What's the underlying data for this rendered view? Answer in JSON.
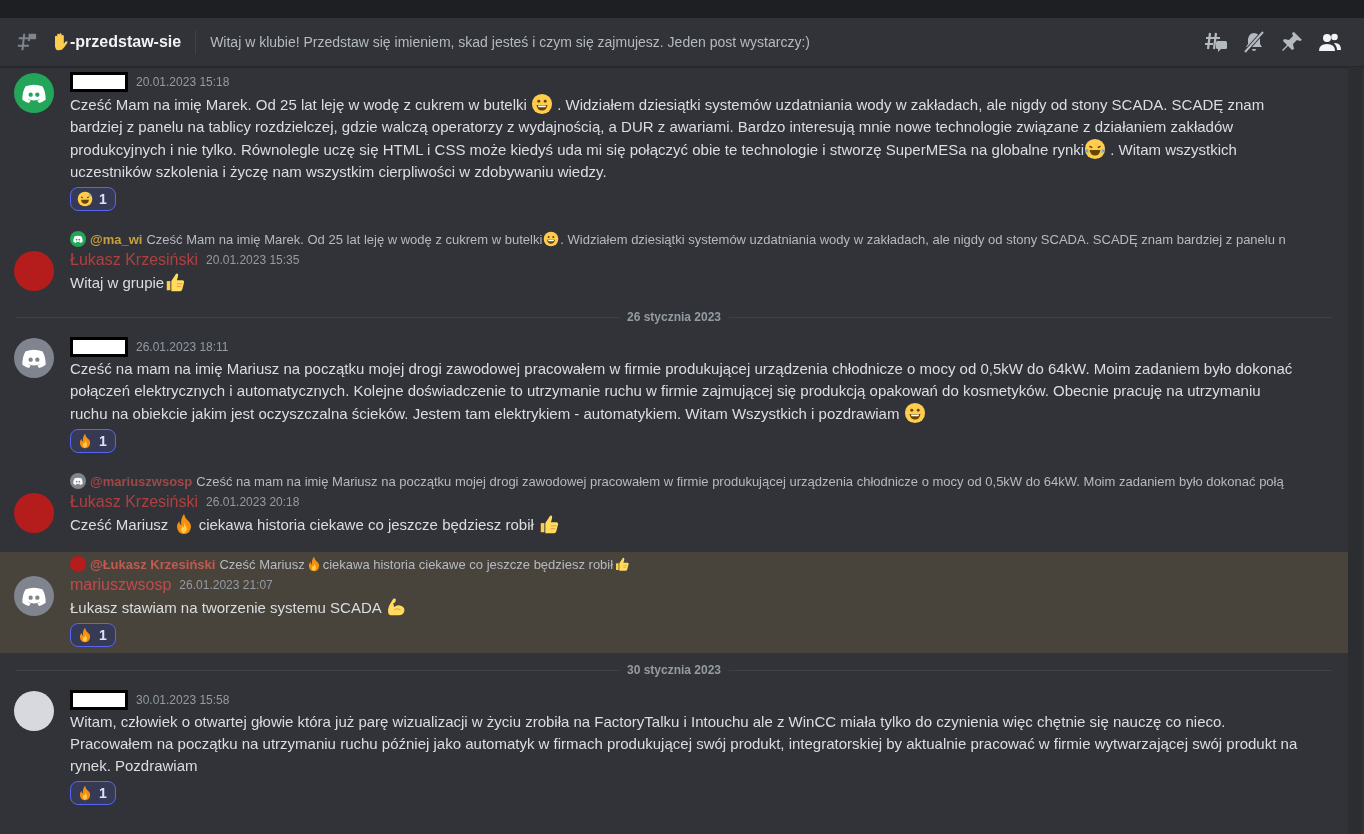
{
  "header": {
    "channel": "-przedstaw-sie",
    "topic": "Witaj w klubie! Przedstaw się imieniem, skad jesteś i czym się zajmujesz. Jeden post wystarczy:)"
  },
  "feed": [
    {
      "kind": "message",
      "avatar": {
        "kind": "logo",
        "color": "#23a55a"
      },
      "time": "20.01.2023 15:18",
      "highlighted": false,
      "content": [
        "Cześć Mam na imię Marek. Od 25 lat leję w wodę z cukrem w butelki ",
        {
          "kind": "grin"
        },
        " . Widziałem dziesiątki systemów uzdatniania wody w zakładach, ale nigdy od stony SCADA. SCADĘ znam bardziej z panelu na tablicy rozdzielczej, gdzie walczą operatorzy z wydajnością, a DUR z awariami. Bardzo interesują mnie nowe technologie związane z działaniem zakładów produkcyjnych i nie tylko.  Równolegle uczę się HTML i CSS może kiedyś uda mi się połączyć obie te technologie i stworzę SuperMESa na globalne rynki",
        {
          "kind": "joy"
        },
        " . Witam wszystkich uczestników szkolenia i życzę nam wszystkim cierpliwości w zdobywaniu wiedzy."
      ],
      "reactions": [
        {
          "kind": "sweat",
          "count": "1",
          "selected": true
        }
      ]
    },
    {
      "kind": "message",
      "avatar": {
        "kind": "photo",
        "color": "#b51c1c"
      },
      "author": {
        "name": "Łukasz Krzesiński",
        "color": "#b04040"
      },
      "time": "20.01.2023 15:35",
      "highlighted": false,
      "reply": {
        "avatar": {
          "kind": "logo",
          "color": "#23a55a"
        },
        "author": "@ma_wi",
        "color": "#c9a03a",
        "content": [
          "Cześć Mam na imię Marek. Od 25 lat leję w wodę z cukrem w butelki ",
          {
            "kind": "grin"
          },
          " . Widziałem dziesiątki systemów uzdatniania wody w zakładach, ale nigdy od stony SCADA. SCADĘ znam bardziej z panelu n"
        ]
      },
      "content": [
        "Witaj w grupie",
        {
          "kind": "thumbs"
        }
      ]
    },
    {
      "kind": "divider",
      "label": "26 stycznia 2023"
    },
    {
      "kind": "message",
      "avatar": {
        "kind": "logo",
        "color": "#80848e"
      },
      "time": "26.01.2023 18:11",
      "highlighted": false,
      "content": [
        "Cześć na mam na imię Mariusz na początku mojej drogi zawodowej pracowałem w firmie produkującej urządzenia chłodnicze o mocy od 0,5kW do 64kW. Moim zadaniem było dokonać połączeń elektrycznych i automatycznych. Kolejne doświadczenie to utrzymanie ruchu w firmie zajmującej się produkcją opakowań do kosmetyków. Obecnie pracuję na utrzymaniu ruchu na obiekcie jakim jest oczyszczalna ścieków. Jestem tam elektrykiem - automatykiem. Witam Wszystkich i pozdrawiam ",
        {
          "kind": "grin"
        }
      ],
      "reactions": [
        {
          "kind": "fire",
          "count": "1",
          "selected": true
        }
      ]
    },
    {
      "kind": "message",
      "avatar": {
        "kind": "photo",
        "color": "#b51c1c"
      },
      "author": {
        "name": "Łukasz Krzesiński",
        "color": "#b04040"
      },
      "time": "26.01.2023 20:18",
      "highlighted": false,
      "reply": {
        "avatar": {
          "kind": "logo",
          "color": "#80848e"
        },
        "author": "@mariuszwsosp",
        "color": "#a04848",
        "content": [
          "Cześć na mam na imię Mariusz na początku mojej drogi zawodowej pracowałem w firmie produkującej urządzenia chłodnicze o mocy od 0,5kW do 64kW. Moim zadaniem było dokonać połą"
        ]
      },
      "content": [
        "Cześć Mariusz ",
        {
          "kind": "fire"
        },
        " ciekawa historia ciekawe co jeszcze będziesz robił ",
        {
          "kind": "thumbs"
        }
      ]
    },
    {
      "kind": "message",
      "avatar": {
        "kind": "logo",
        "color": "#80848e"
      },
      "author": {
        "name": "mariuszwsosp",
        "color": "#c24a4a"
      },
      "time": "26.01.2023 21:07",
      "highlighted": true,
      "reply": {
        "avatar": {
          "kind": "photo",
          "color": "#b51c1c"
        },
        "author": "@Łukasz Krzesiński",
        "color": "#c25a50",
        "content": [
          "Cześć Mariusz ",
          {
            "kind": "fire"
          },
          " ciekawa historia ciekawe co jeszcze będziesz robił ",
          {
            "kind": "thumbs"
          }
        ]
      },
      "content": [
        "Łukasz stawiam na tworzenie systemu SCADA ",
        {
          "kind": "muscle"
        }
      ],
      "reactions": [
        {
          "kind": "fire",
          "count": "1",
          "selected": true
        }
      ]
    },
    {
      "kind": "divider",
      "label": "30 stycznia 2023"
    },
    {
      "kind": "message",
      "avatar": {
        "kind": "photo",
        "color": "#d7d9de"
      },
      "time": "30.01.2023 15:58",
      "highlighted": false,
      "content": [
        "Witam, człowiek o otwartej głowie która już parę wizualizacji w życiu zrobiła na FactoryTalku i Intouchu ale z WinCC miała tylko do czynienia więc chętnie się nauczę co nieco. Pracowałem na początku na utrzymaniu ruchu później jako automatyk w firmach produkującej swój produkt, integratorskiej by aktualnie pracować w firmie wytwarzającej swój produkt na rynek. Pozdrawiam"
      ],
      "reactions": [
        {
          "kind": "fire",
          "count": "1",
          "selected": true
        }
      ]
    }
  ]
}
